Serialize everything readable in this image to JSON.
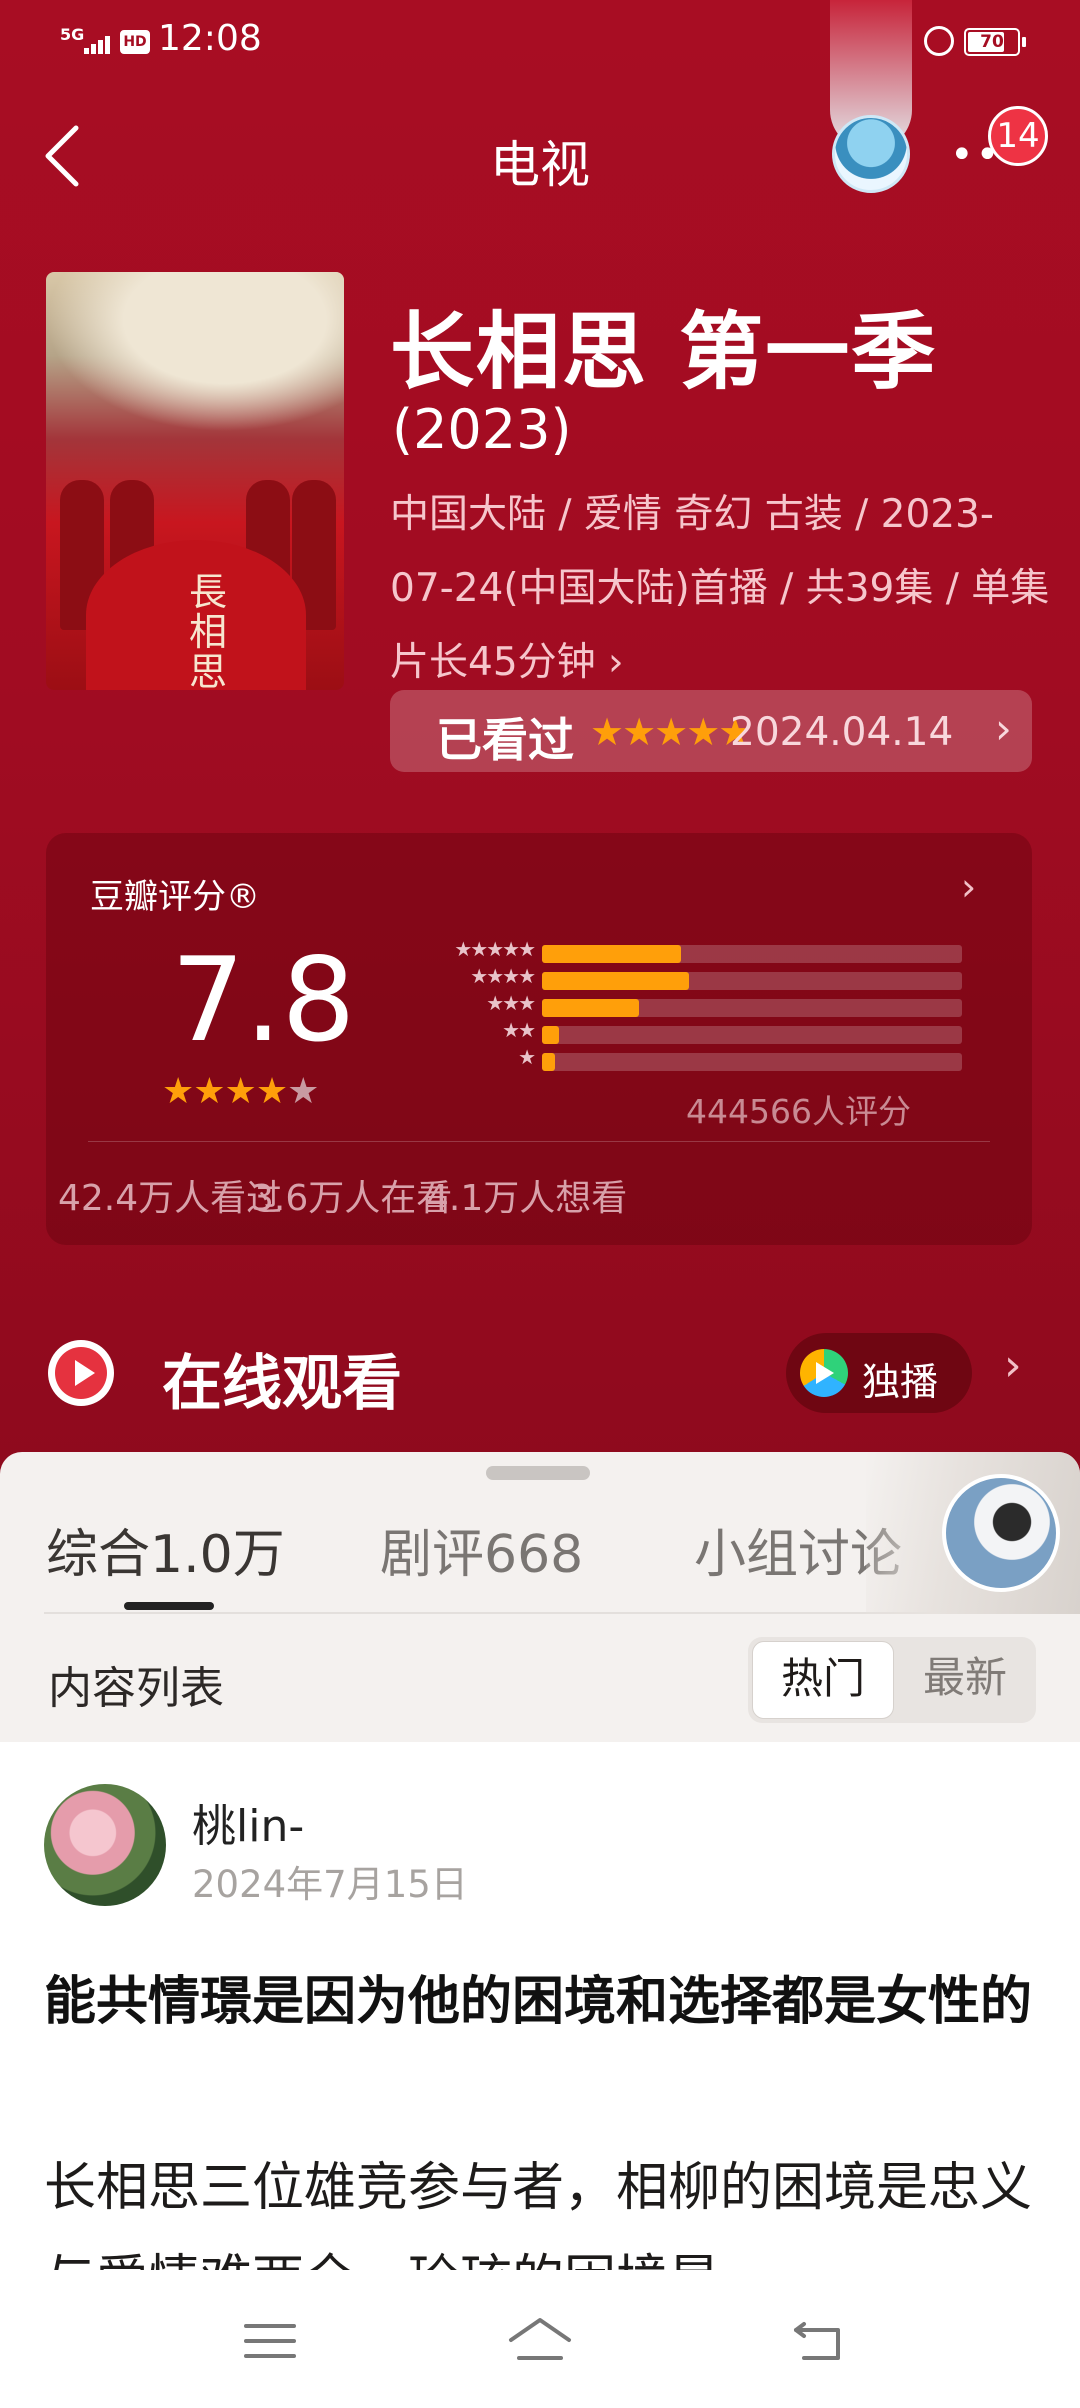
{
  "status_bar": {
    "network": "5G",
    "hd": "HD",
    "time": "12:08",
    "battery": "70"
  },
  "header": {
    "title": "电视",
    "badge_count": "14"
  },
  "show": {
    "title": "长相思 第一季",
    "year": "(2023)",
    "meta": "中国大陆 / 爱情 奇幻 古装 / 2023-07-24(中国大陆)首播 / 共39集 / 单集片长45分钟 ›",
    "poster_text": "長相思",
    "watched": {
      "label": "已看过",
      "stars": "★★★★★",
      "date": "2024.04.14"
    }
  },
  "rating": {
    "title": "豆瓣评分®",
    "score": "7.8",
    "stars": "★★★★",
    "stars_off": "★",
    "distribution": [
      {
        "stars": "★★★★★",
        "fraction": 0.33
      },
      {
        "stars": "★★★★",
        "fraction": 0.35
      },
      {
        "stars": "★★★",
        "fraction": 0.23
      },
      {
        "stars": "★★",
        "fraction": 0.04
      },
      {
        "stars": "★",
        "fraction": 0.03
      }
    ],
    "count": "444566人评分",
    "stats": [
      "42.4万人看过",
      "3.6万人在看",
      "4.1万人想看"
    ]
  },
  "online": {
    "title": "在线观看",
    "exclusive_label": "独播"
  },
  "tabs": [
    {
      "label": "综合1.0万",
      "active": true
    },
    {
      "label": "剧评668",
      "active": false
    },
    {
      "label": "小组讨论",
      "active": false
    }
  ],
  "list": {
    "header": "内容列表",
    "sort_hot": "热门",
    "sort_new": "最新"
  },
  "post": {
    "user": "桃lin-",
    "date": "2024年7月15日",
    "title": "能共情璟是因为他的困境和选择都是女性的",
    "body": "长相思三位雄竞参与者，相柳的困境是忠义与爱情难两全，玱玹的困境是"
  },
  "colors": {
    "accent_red": "#a80d23",
    "star_orange": "#ff9f0a",
    "play_red": "#e5323f"
  },
  "icons": [
    "back-arrow-icon",
    "more-icon",
    "play-icon",
    "tencent-video-icon",
    "chevron-right-icon",
    "menu-icon",
    "home-icon",
    "back-nav-icon"
  ]
}
